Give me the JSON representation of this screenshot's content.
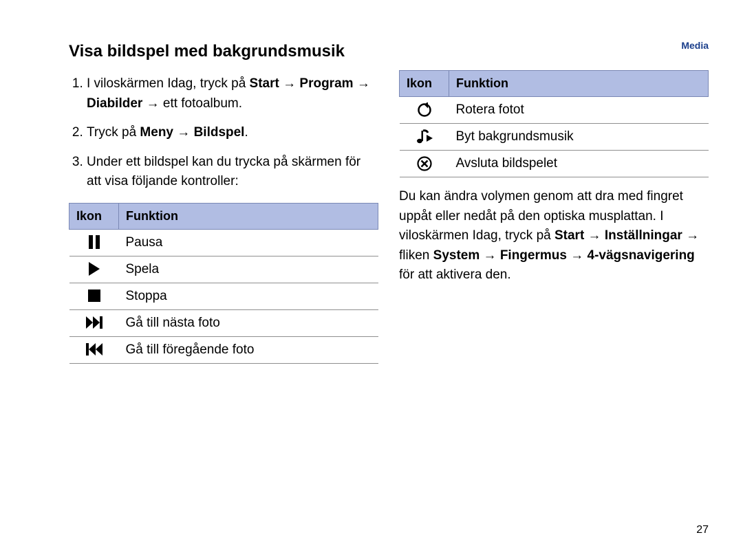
{
  "header": {
    "label": "Media"
  },
  "left": {
    "title": "Visa bildspel med bakgrundsmusik",
    "steps": [
      {
        "prefix": "I viloskärmen Idag, tryck på ",
        "bold1": "Start",
        "arrow1": " → ",
        "bold2": "Program",
        "arrow2": " → ",
        "bold3": "Diabilder",
        "arrow3": " → ",
        "suffix": "ett fotoalbum."
      },
      {
        "prefix": "Tryck på ",
        "bold1": "Meny",
        "arrow1": " → ",
        "bold2": "Bildspel",
        "suffix": "."
      },
      {
        "text": "Under ett bildspel kan du trycka på skärmen för att visa följande kontroller:"
      }
    ],
    "tableHeader": {
      "ikon": "Ikon",
      "funktion": "Funktion"
    },
    "rows": [
      {
        "icon": "pause-icon",
        "label": "Pausa"
      },
      {
        "icon": "play-icon",
        "label": "Spela"
      },
      {
        "icon": "stop-icon",
        "label": "Stoppa"
      },
      {
        "icon": "next-icon",
        "label": "Gå till nästa foto"
      },
      {
        "icon": "prev-icon",
        "label": "Gå till föregående foto"
      }
    ]
  },
  "right": {
    "tableHeader": {
      "ikon": "Ikon",
      "funktion": "Funktion"
    },
    "rows": [
      {
        "icon": "rotate-icon",
        "label": "Rotera fotot"
      },
      {
        "icon": "music-icon",
        "label": "Byt bakgrundsmusik"
      },
      {
        "icon": "close-icon",
        "label": "Avsluta bildspelet"
      }
    ],
    "para": {
      "p1": "Du kan ändra volymen genom att dra med fingret uppåt eller nedåt på den optiska musplattan. I viloskärmen Idag, tryck på ",
      "b1": "Start",
      "a1": " → ",
      "b2": "Inställningar",
      "a2": " → fliken ",
      "b3": "System",
      "a3": " → ",
      "b4": "Fingermus",
      "a4": " → ",
      "b5": "4-vägsnavigering",
      "p2": " för att aktivera den."
    }
  },
  "pageNumber": "27"
}
